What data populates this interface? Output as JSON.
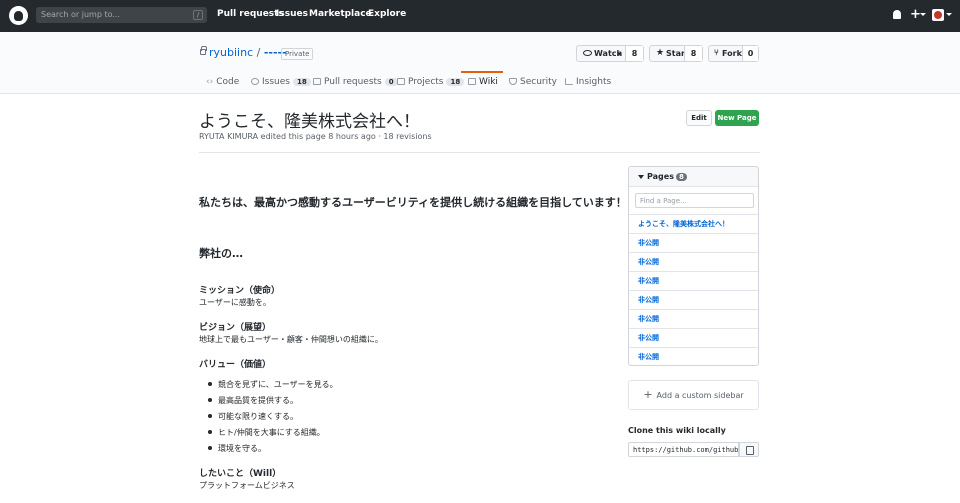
{
  "header": {
    "search_placeholder": "Search or jump to...",
    "search_shortcut": "/",
    "nav": [
      "Pull requests",
      "Issues",
      "Marketplace",
      "Explore"
    ],
    "plus": "+"
  },
  "repo": {
    "owner": "ryubiinc",
    "separator": "/",
    "name": "-----",
    "visibility": "Private",
    "watch_label": "Watch",
    "watch_count": "8",
    "star_label": "Star",
    "star_count": "8",
    "fork_label": "Fork",
    "fork_count": "0"
  },
  "tabs": [
    {
      "label": "Code"
    },
    {
      "label": "Issues",
      "count": "18"
    },
    {
      "label": "Pull requests",
      "count": "0"
    },
    {
      "label": "Projects",
      "count": "18"
    },
    {
      "label": "Wiki"
    },
    {
      "label": "Security"
    },
    {
      "label": "Insights"
    }
  ],
  "wiki": {
    "title": "ようこそ、隆美株式会社へ！",
    "meta": "RYUTA KIMURA edited this page 8 hours ago · 18 revisions",
    "edit_label": "Edit",
    "new_page_label": "New Page",
    "lead": "私たちは、最高かつ感動するユーザービリティを提供し続ける組織を目指しています！",
    "section": "弊社の…",
    "mission_h": "ミッション（使命）",
    "mission_p": "ユーザーに感動を。",
    "vision_h": "ビジョン（展望）",
    "vision_p": "地球上で最もユーザー・顧客・仲間想いの組織に。",
    "value_h": "バリュー（価値）",
    "values": [
      "競合を見ずに、ユーザーを見る。",
      "最高品質を提供する。",
      "可能な限り速くする。",
      "ヒト/仲間を大事にする組織。",
      "環境を守る。"
    ],
    "will_h": "したいこと（Will）",
    "will_p": "プラットフォームビジネス"
  },
  "sidebar": {
    "pages_label": "Pages",
    "pages_count": "8",
    "find_placeholder": "Find a Page…",
    "pages": [
      "ようこそ、隆美株式会社へ！",
      "非公開",
      "非公開",
      "非公開",
      "非公開",
      "非公開",
      "非公開",
      "非公開"
    ],
    "add_sidebar": "Add a custom sidebar",
    "clone_title": "Clone this wiki locally",
    "clone_url": "https://github.com/github"
  }
}
